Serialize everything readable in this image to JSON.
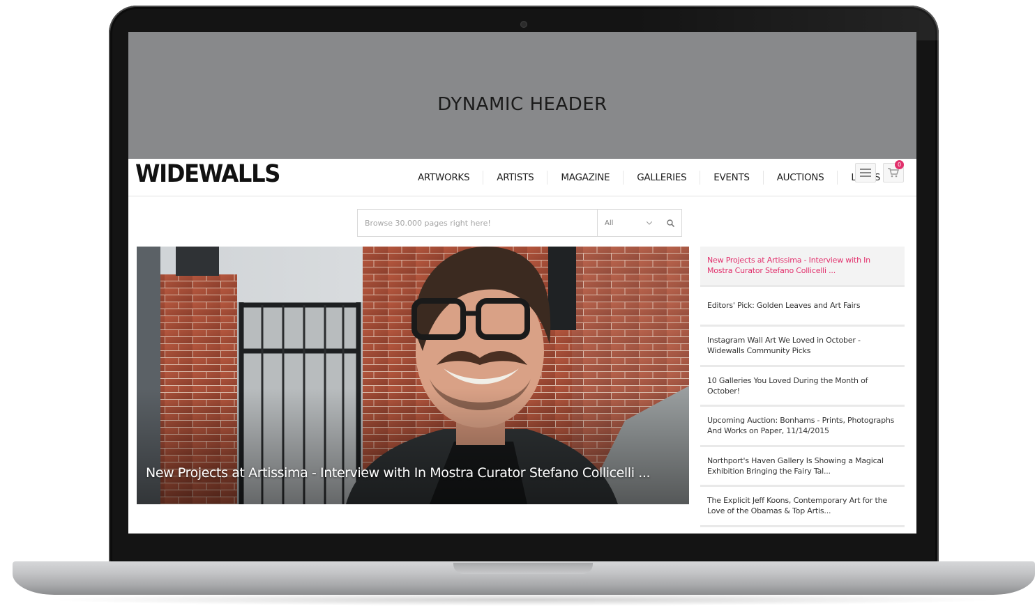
{
  "header": {
    "label": "DYNAMIC HEADER"
  },
  "nav": {
    "logo": "WIDEWALLS",
    "links": [
      "ARTWORKS",
      "ARTISTS",
      "MAGAZINE",
      "GALLERIES",
      "EVENTS",
      "AUCTIONS",
      "LUKAS"
    ],
    "cart_count": "0"
  },
  "search": {
    "placeholder": "Browse 30.000 pages right here!",
    "category": "All"
  },
  "hero": {
    "caption": "New Projects at Artissima - Interview with In Mostra Curator Stefano Collicelli ..."
  },
  "articles": [
    {
      "title": "New Projects at Artissima - Interview with In Mostra Curator Stefano Collicelli ...",
      "active": true
    },
    {
      "title": "Editors' Pick: Golden Leaves and Art Fairs"
    },
    {
      "title": "Instagram Wall Art We Loved in October - Widewalls Community Picks"
    },
    {
      "title": "10 Galleries You Loved During the Month of October!"
    },
    {
      "title": "Upcoming Auction: Bonhams - Prints, Photographs And Works on Paper, 11/14/2015"
    },
    {
      "title": "Northport's Haven Gallery Is Showing a Magical Exhibition Bringing the Fairy Tal..."
    },
    {
      "title": "The Explicit Jeff Koons, Contemporary Art for the Love of the Obamas & Top Artis..."
    }
  ],
  "colors": {
    "accent": "#e2306c",
    "header_bg": "#88898b"
  }
}
